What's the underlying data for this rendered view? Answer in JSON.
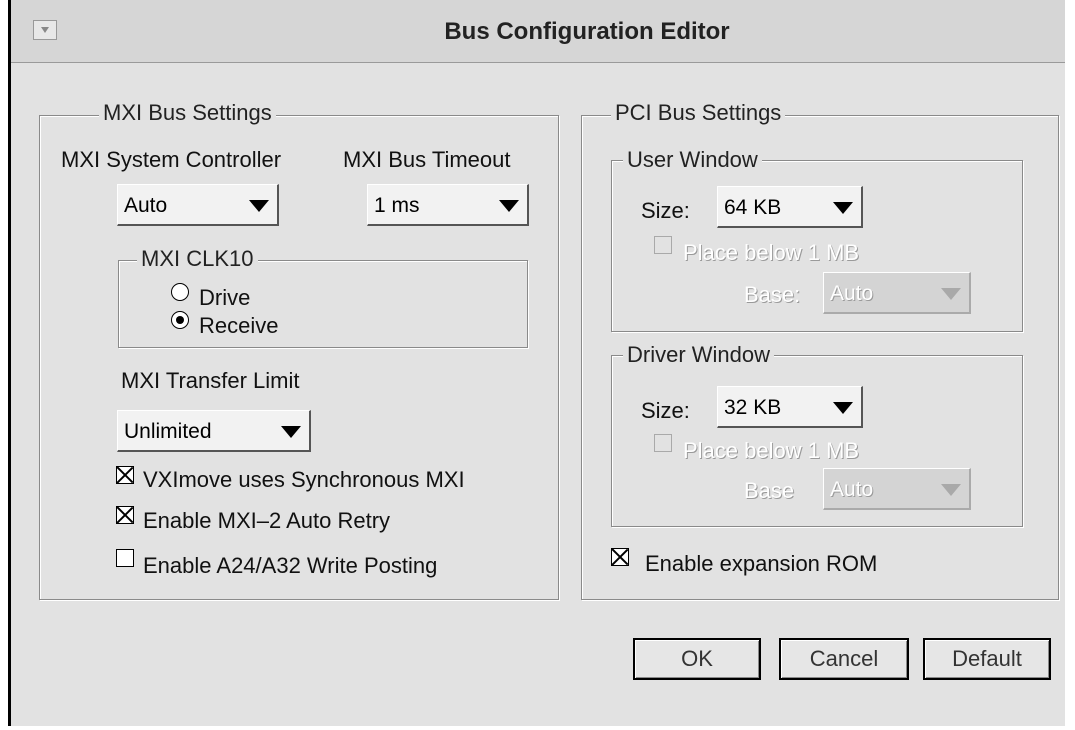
{
  "window": {
    "title": "Bus Configuration Editor"
  },
  "mxi": {
    "legend": "MXI Bus Settings",
    "system_controller_label": "MXI System Controller",
    "system_controller_value": "Auto",
    "bus_timeout_label": "MXI Bus Timeout",
    "bus_timeout_value": "1 ms",
    "clk10": {
      "legend": "MXI CLK10",
      "options": [
        "Drive",
        "Receive"
      ],
      "selected": "Receive"
    },
    "transfer_limit_label": "MXI Transfer Limit",
    "transfer_limit_value": "Unlimited",
    "checkboxes": [
      {
        "label": "VXImove uses Synchronous MXI",
        "checked": true
      },
      {
        "label": "Enable MXI–2 Auto Retry",
        "checked": true
      },
      {
        "label": "Enable A24/A32 Write Posting",
        "checked": false
      }
    ]
  },
  "pci": {
    "legend": "PCI Bus Settings",
    "user_window": {
      "legend": "User Window",
      "size_label": "Size:",
      "size_value": "64 KB",
      "place_below_label": "Place below 1 MB",
      "base_label": "Base:",
      "base_value": "Auto"
    },
    "driver_window": {
      "legend": "Driver Window",
      "size_label": "Size:",
      "size_value": "32 KB",
      "place_below_label": "Place below 1 MB",
      "base_label": "Base",
      "base_value": "Auto"
    },
    "expansion_rom": {
      "label": "Enable expansion ROM",
      "checked": true
    }
  },
  "buttons": {
    "ok": "OK",
    "cancel": "Cancel",
    "default": "Default"
  },
  "colors": {
    "background": "#e2e2e2",
    "titlebar": "#d6d6d6",
    "disabled_text": "#ffffff"
  }
}
